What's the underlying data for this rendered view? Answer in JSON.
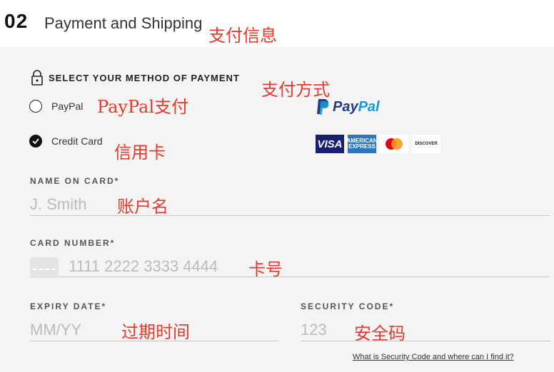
{
  "header": {
    "step_number": "02",
    "title": "Payment and Shipping",
    "annotation": "支付信息"
  },
  "payment_method": {
    "heading": "SELECT YOUR METHOD OF PAYMENT",
    "annotation": "支付方式",
    "options": [
      {
        "label": "PayPal",
        "annotation": "PayPal支付",
        "selected": false
      },
      {
        "label": "Credit Card",
        "annotation": "信用卡",
        "selected": true
      }
    ],
    "paypal_logo": {
      "pay": "Pay",
      "pal": "Pal"
    },
    "card_logos": [
      "visa-logo",
      "amex-logo",
      "mastercard-logo",
      "discover-logo"
    ],
    "visa_text": "VISA",
    "amex_text": "AMERICAN EXPRESS",
    "discover_text": "DISCOVER"
  },
  "fields": {
    "name": {
      "label": "NAME ON CARD*",
      "placeholder": "J. Smith",
      "annotation": "账户名"
    },
    "number": {
      "label": "CARD NUMBER*",
      "placeholder": "1111 2222 3333 4444",
      "annotation": "卡号"
    },
    "expiry": {
      "label": "EXPIRY DATE*",
      "placeholder": "MM/YY",
      "annotation": "过期时间"
    },
    "security": {
      "label": "SECURITY CODE*",
      "placeholder": "123",
      "annotation": "安全码"
    }
  },
  "help_link": "What is Security Code and where can I find it?",
  "colors": {
    "annotation_red": "#e8392c",
    "panel_bg": "#f4f4f4",
    "paypal_dark": "#253b80",
    "paypal_light": "#179bd7"
  }
}
